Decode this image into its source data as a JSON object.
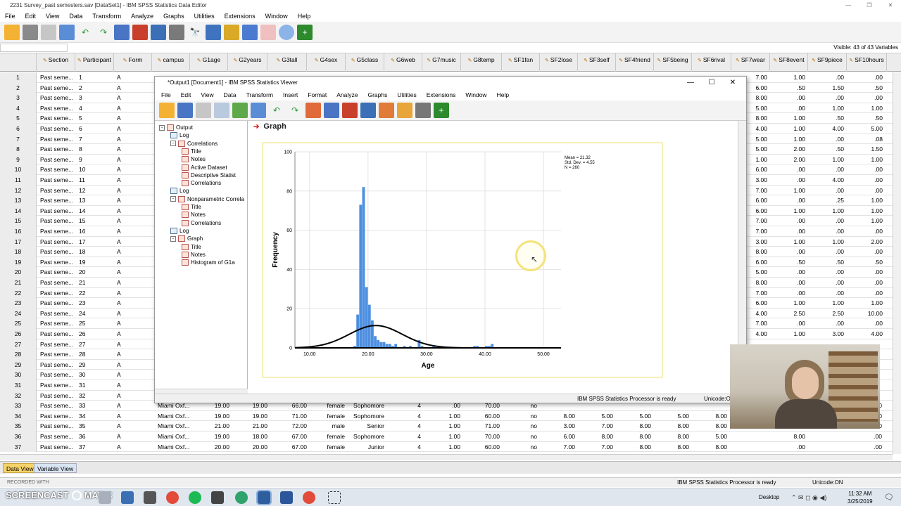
{
  "window_title": "2231 Survey_past semesters.sav [DataSet1] - IBM SPSS Statistics Data Editor",
  "menu": [
    "File",
    "Edit",
    "View",
    "Data",
    "Transform",
    "Analyze",
    "Graphs",
    "Utilities",
    "Extensions",
    "Window",
    "Help"
  ],
  "visible_vars": "Visible: 43 of 43 Variables",
  "columns": [
    {
      "label": "Section"
    },
    {
      "label": "Participant"
    },
    {
      "label": "Form"
    },
    {
      "label": "campus"
    },
    {
      "label": "G1age"
    },
    {
      "label": "G2years"
    },
    {
      "label": "G3tall"
    },
    {
      "label": "G4sex"
    },
    {
      "label": "G5class"
    },
    {
      "label": "G6web"
    },
    {
      "label": "G7music"
    },
    {
      "label": "G8temp"
    },
    {
      "label": "SF1fan"
    },
    {
      "label": "SF2lose"
    },
    {
      "label": "SF3self"
    },
    {
      "label": "SF4friend"
    },
    {
      "label": "SF5being"
    },
    {
      "label": "SF6rival"
    },
    {
      "label": "SF7wear"
    },
    {
      "label": "SF8event"
    },
    {
      "label": "SF9piece"
    },
    {
      "label": "SF10hours"
    }
  ],
  "rows": [
    {
      "n": "1",
      "s": "Past seme...",
      "p": "1",
      "f": "A",
      "r": [
        "7.00",
        "1.00",
        ".00",
        ".00"
      ]
    },
    {
      "n": "2",
      "s": "Past seme...",
      "p": "2",
      "f": "A",
      "r": [
        "6.00",
        ".50",
        "1.50",
        ".50"
      ]
    },
    {
      "n": "3",
      "s": "Past seme...",
      "p": "3",
      "f": "A",
      "r": [
        "8.00",
        ".00",
        ".00",
        ".00"
      ]
    },
    {
      "n": "4",
      "s": "Past seme...",
      "p": "4",
      "f": "A",
      "r": [
        "5.00",
        ".00",
        "1.00",
        "1.00"
      ]
    },
    {
      "n": "5",
      "s": "Past seme...",
      "p": "5",
      "f": "A",
      "r": [
        "8.00",
        "1.00",
        ".50",
        ".50"
      ]
    },
    {
      "n": "6",
      "s": "Past seme...",
      "p": "6",
      "f": "A",
      "r": [
        "4.00",
        "1.00",
        "4.00",
        "5.00"
      ]
    },
    {
      "n": "7",
      "s": "Past seme...",
      "p": "7",
      "f": "A",
      "r": [
        "5.00",
        "1.00",
        ".00",
        ".08"
      ]
    },
    {
      "n": "8",
      "s": "Past seme...",
      "p": "8",
      "f": "A",
      "r": [
        "5.00",
        "2.00",
        ".50",
        "1.50"
      ]
    },
    {
      "n": "9",
      "s": "Past seme...",
      "p": "9",
      "f": "A",
      "r": [
        "1.00",
        "2.00",
        "1.00",
        "1.00"
      ]
    },
    {
      "n": "10",
      "s": "Past seme...",
      "p": "10",
      "f": "A",
      "r": [
        "6.00",
        ".00",
        ".00",
        ".00"
      ]
    },
    {
      "n": "11",
      "s": "Past seme...",
      "p": "11",
      "f": "A",
      "r": [
        "3.00",
        ".00",
        "4.00",
        ".00"
      ]
    },
    {
      "n": "12",
      "s": "Past seme...",
      "p": "12",
      "f": "A",
      "r": [
        "7.00",
        "1.00",
        ".00",
        ".00"
      ]
    },
    {
      "n": "13",
      "s": "Past seme...",
      "p": "13",
      "f": "A",
      "r": [
        "6.00",
        ".00",
        ".25",
        "1.00"
      ]
    },
    {
      "n": "14",
      "s": "Past seme...",
      "p": "14",
      "f": "A",
      "r": [
        "6.00",
        "1.00",
        "1.00",
        "1.00"
      ]
    },
    {
      "n": "15",
      "s": "Past seme...",
      "p": "15",
      "f": "A",
      "r": [
        "7.00",
        ".00",
        ".00",
        "1.00"
      ]
    },
    {
      "n": "16",
      "s": "Past seme...",
      "p": "16",
      "f": "A",
      "r": [
        "7.00",
        ".00",
        ".00",
        ".00"
      ]
    },
    {
      "n": "17",
      "s": "Past seme...",
      "p": "17",
      "f": "A",
      "r": [
        "3.00",
        "1.00",
        "1.00",
        "2.00"
      ]
    },
    {
      "n": "18",
      "s": "Past seme...",
      "p": "18",
      "f": "A",
      "r": [
        "8.00",
        ".00",
        ".00",
        ".00"
      ]
    },
    {
      "n": "19",
      "s": "Past seme...",
      "p": "19",
      "f": "A",
      "r": [
        "6.00",
        ".50",
        ".50",
        ".50"
      ]
    },
    {
      "n": "20",
      "s": "Past seme...",
      "p": "20",
      "f": "A",
      "r": [
        "5.00",
        ".00",
        ".00",
        ".00"
      ]
    },
    {
      "n": "21",
      "s": "Past seme...",
      "p": "21",
      "f": "A",
      "r": [
        "8.00",
        ".00",
        ".00",
        ".00"
      ]
    },
    {
      "n": "22",
      "s": "Past seme...",
      "p": "22",
      "f": "A",
      "r": [
        "7.00",
        ".00",
        ".00",
        ".00"
      ]
    },
    {
      "n": "23",
      "s": "Past seme...",
      "p": "23",
      "f": "A",
      "r": [
        "6.00",
        "1.00",
        "1.00",
        "1.00"
      ]
    },
    {
      "n": "24",
      "s": "Past seme...",
      "p": "24",
      "f": "A",
      "r": [
        "4.00",
        "2.50",
        "2.50",
        "10.00"
      ]
    },
    {
      "n": "25",
      "s": "Past seme...",
      "p": "25",
      "f": "A",
      "r": [
        "7.00",
        ".00",
        ".00",
        ".00"
      ]
    },
    {
      "n": "26",
      "s": "Past seme...",
      "p": "26",
      "f": "A",
      "r": [
        "4.00",
        "1.00",
        "3.00",
        "4.00"
      ]
    },
    {
      "n": "27",
      "s": "Past seme...",
      "p": "27",
      "f": "A",
      "r": [
        "",
        "",
        "",
        ""
      ]
    },
    {
      "n": "28",
      "s": "Past seme...",
      "p": "28",
      "f": "A",
      "r": [
        "",
        "",
        "",
        ""
      ]
    },
    {
      "n": "29",
      "s": "Past seme...",
      "p": "29",
      "f": "A",
      "r": [
        "",
        "",
        "",
        ""
      ]
    },
    {
      "n": "30",
      "s": "Past seme...",
      "p": "30",
      "f": "A",
      "r": [
        "",
        "",
        "",
        ""
      ]
    },
    {
      "n": "31",
      "s": "Past seme...",
      "p": "31",
      "f": "A",
      "r": [
        "",
        "",
        "",
        ""
      ]
    },
    {
      "n": "32",
      "s": "Past seme...",
      "p": "32",
      "f": "A",
      "r": [
        "",
        "",
        "",
        ""
      ]
    }
  ],
  "full_rows": [
    {
      "n": "33",
      "s": "Past seme...",
      "p": "33",
      "f": "A",
      "c": "Miami Oxf...",
      "a": "19.00",
      "y": "19.00",
      "t": "66.00",
      "sx": "female",
      "cl": "Sophomore",
      "w": "4",
      "m": ".00",
      "tp": "70.00",
      "v": [
        "no",
        "",
        "",
        "",
        "",
        "",
        ".00",
        ".00"
      ]
    },
    {
      "n": "34",
      "s": "Past seme...",
      "p": "34",
      "f": "A",
      "c": "Miami Oxf...",
      "a": "19.00",
      "y": "19.00",
      "t": "71.00",
      "sx": "female",
      "cl": "Sophomore",
      "w": "4",
      "m": "1.00",
      "tp": "60.00",
      "v": [
        "no",
        "8.00",
        "5.00",
        "5.00",
        "5.00",
        "8.00",
        ".00",
        ".00"
      ]
    },
    {
      "n": "35",
      "s": "Past seme...",
      "p": "35",
      "f": "A",
      "c": "Miami Oxf...",
      "a": "21.00",
      "y": "21.00",
      "t": "72.00",
      "sx": "male",
      "cl": "Senior",
      "w": "4",
      "m": "1.00",
      "tp": "71.00",
      "v": [
        "no",
        "3.00",
        "7.00",
        "8.00",
        "8.00",
        "8.00",
        ".00",
        ".00"
      ]
    },
    {
      "n": "36",
      "s": "Past seme...",
      "p": "36",
      "f": "A",
      "c": "Miami Oxf...",
      "a": "19.00",
      "y": "18.00",
      "t": "67.00",
      "sx": "female",
      "cl": "Sophomore",
      "w": "4",
      "m": "1.00",
      "tp": "70.00",
      "v": [
        "no",
        "6.00",
        "8.00",
        "8.00",
        "8.00",
        "5.00",
        "8.00",
        ".00"
      ]
    },
    {
      "n": "37",
      "s": "Past seme...",
      "p": "37",
      "f": "A",
      "c": "Miami Oxf...",
      "a": "20.00",
      "y": "20.00",
      "t": "67.00",
      "sx": "female",
      "cl": "Junior",
      "w": "4",
      "m": "1.00",
      "tp": "60.00",
      "v": [
        "no",
        "7.00",
        "7.00",
        "8.00",
        "8.00",
        "8.00",
        ".00",
        ".00"
      ]
    }
  ],
  "viewer": {
    "title": "*Output1 [Document1] - IBM SPSS Statistics Viewer",
    "menu": [
      "File",
      "Edit",
      "View",
      "Data",
      "Transform",
      "Insert",
      "Format",
      "Analyze",
      "Graphs",
      "Utilities",
      "Extensions",
      "Window",
      "Help"
    ],
    "outline": [
      {
        "label": "Output",
        "lvl": 0,
        "kind": "book",
        "exp": "-"
      },
      {
        "label": "Log",
        "lvl": 1,
        "kind": "lg",
        "exp": ""
      },
      {
        "label": "Correlations",
        "lvl": 1,
        "kind": "book",
        "exp": "-"
      },
      {
        "label": "Title",
        "lvl": 2,
        "kind": "item",
        "exp": ""
      },
      {
        "label": "Notes",
        "lvl": 2,
        "kind": "item",
        "exp": ""
      },
      {
        "label": "Active Dataset",
        "lvl": 2,
        "kind": "item",
        "exp": ""
      },
      {
        "label": "Descriptive Statist",
        "lvl": 2,
        "kind": "item",
        "exp": ""
      },
      {
        "label": "Correlations",
        "lvl": 2,
        "kind": "item",
        "exp": ""
      },
      {
        "label": "Log",
        "lvl": 1,
        "kind": "lg",
        "exp": ""
      },
      {
        "label": "Nonparametric Correla",
        "lvl": 1,
        "kind": "book",
        "exp": "-"
      },
      {
        "label": "Title",
        "lvl": 2,
        "kind": "item",
        "exp": ""
      },
      {
        "label": "Notes",
        "lvl": 2,
        "kind": "item",
        "exp": ""
      },
      {
        "label": "Correlations",
        "lvl": 2,
        "kind": "item",
        "exp": ""
      },
      {
        "label": "Log",
        "lvl": 1,
        "kind": "lg",
        "exp": ""
      },
      {
        "label": "Graph",
        "lvl": 1,
        "kind": "book",
        "exp": "-"
      },
      {
        "label": "Title",
        "lvl": 2,
        "kind": "item",
        "exp": ""
      },
      {
        "label": "Notes",
        "lvl": 2,
        "kind": "item",
        "exp": ""
      },
      {
        "label": "Histogram of G1a",
        "lvl": 2,
        "kind": "item",
        "exp": ""
      }
    ],
    "graph_heading": "Graph",
    "status": "IBM SPSS Statistics Processor is ready",
    "unicode": "Unicode:O"
  },
  "chart_data": {
    "type": "bar",
    "xlabel": "Age",
    "ylabel": "Frequency",
    "xlim": [
      7.5,
      53
    ],
    "ylim": [
      0,
      100
    ],
    "xticks": [
      "10.00",
      "20.00",
      "30.00",
      "40.00",
      "50.00"
    ],
    "xtick_values": [
      10,
      20,
      30,
      40,
      50
    ],
    "yticks": [
      "0",
      "20",
      "40",
      "60",
      "80",
      "100"
    ],
    "bin_width": 0.5,
    "bins": [
      {
        "x": 17.5,
        "y": 1
      },
      {
        "x": 18.0,
        "y": 17
      },
      {
        "x": 18.5,
        "y": 73
      },
      {
        "x": 19.0,
        "y": 82
      },
      {
        "x": 19.5,
        "y": 31
      },
      {
        "x": 20.0,
        "y": 22
      },
      {
        "x": 20.5,
        "y": 14
      },
      {
        "x": 21.0,
        "y": 6
      },
      {
        "x": 21.5,
        "y": 4
      },
      {
        "x": 22.0,
        "y": 3
      },
      {
        "x": 22.5,
        "y": 3
      },
      {
        "x": 23.0,
        "y": 2
      },
      {
        "x": 23.5,
        "y": 2
      },
      {
        "x": 24.0,
        "y": 1
      },
      {
        "x": 24.5,
        "y": 2
      },
      {
        "x": 26.0,
        "y": 1
      },
      {
        "x": 27.0,
        "y": 1
      },
      {
        "x": 28.5,
        "y": 4
      },
      {
        "x": 29.0,
        "y": 1
      },
      {
        "x": 31.0,
        "y": 1
      },
      {
        "x": 38.0,
        "y": 1
      },
      {
        "x": 38.5,
        "y": 1
      },
      {
        "x": 40.0,
        "y": 1
      },
      {
        "x": 40.5,
        "y": 1
      },
      {
        "x": 41.0,
        "y": 2
      }
    ],
    "normal_curve": {
      "mean": 21.32,
      "sd": 4.55,
      "n": 260
    },
    "stats_box": [
      "Mean = 21.32",
      "Std. Dev. = 4.55",
      "N = 260"
    ],
    "colors": {
      "bar": "#4d8fe0",
      "curve": "#000000",
      "frame": "#f2eba0"
    }
  },
  "bottom": {
    "data_view": "Data View",
    "variable_view": "Variable View",
    "status": "IBM SPSS Statistics Processor is ready",
    "unicode": "Unicode:ON",
    "watermark1": "RECORDED WITH",
    "watermark2": "SCREENCAST",
    "watermark3": "MATIC"
  },
  "taskbar": {
    "desktop": "Desktop",
    "time": "11:32 AM",
    "date": "3/25/2019"
  }
}
